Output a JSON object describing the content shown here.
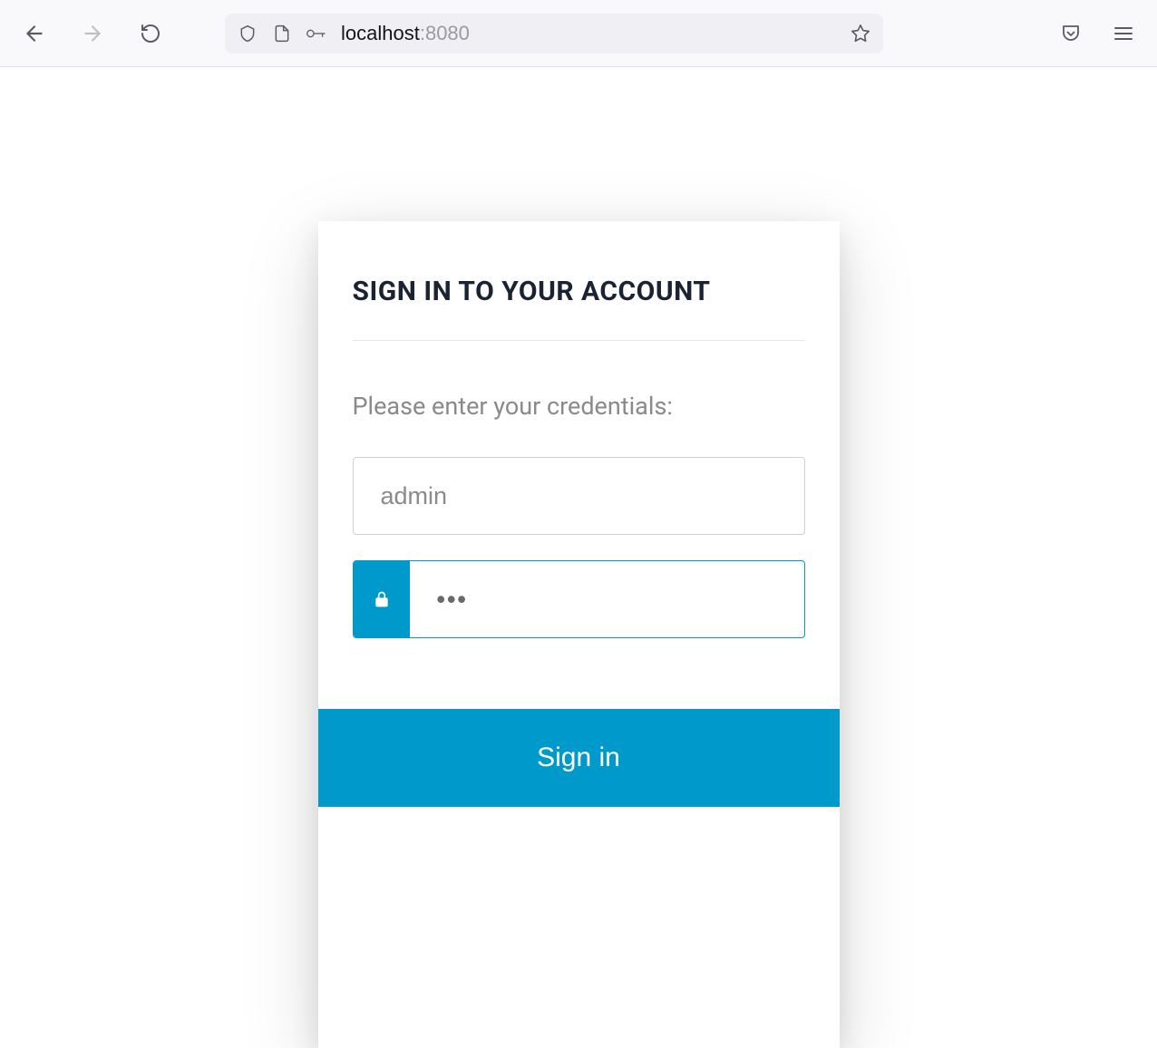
{
  "browser": {
    "url_host": "localhost",
    "url_port": ":8080"
  },
  "login": {
    "title": "SIGN IN TO YOUR ACCOUNT",
    "instruction": "Please enter your credentials:",
    "username_value": "admin",
    "password_value": "•••",
    "sign_in_label": "Sign in"
  },
  "colors": {
    "accent": "#0099cc",
    "title": "#1a2332"
  }
}
